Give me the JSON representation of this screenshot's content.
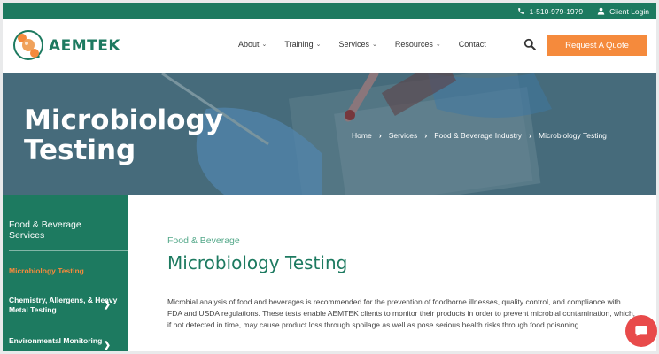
{
  "topbar": {
    "phone": "1-510-979-1979",
    "login": "Client Login"
  },
  "brand": {
    "name": "AEMTEK",
    "primary_color": "#1d7a60",
    "accent_color": "#f58a3c"
  },
  "nav": {
    "items": [
      {
        "label": "About",
        "has_dropdown": true
      },
      {
        "label": "Training",
        "has_dropdown": true
      },
      {
        "label": "Services",
        "has_dropdown": true
      },
      {
        "label": "Resources",
        "has_dropdown": true
      },
      {
        "label": "Contact",
        "has_dropdown": false
      }
    ],
    "cta": "Request A Quote"
  },
  "hero": {
    "title_line1": "Microbiology",
    "title_line2": "Testing",
    "breadcrumb": [
      "Home",
      "Services",
      "Food & Beverage Industry",
      "Microbiology Testing"
    ]
  },
  "sidebar": {
    "title": "Food & Beverage Services",
    "active_item": "Microbiology Testing",
    "items": [
      {
        "label": "Chemistry, Allergens, & Heavy Metal Testing"
      },
      {
        "label": "Environmental Monitoring"
      }
    ]
  },
  "main": {
    "eyebrow": "Food & Beverage",
    "title": "Microbiology Testing",
    "paragraph": "Microbial analysis of food and beverages is recommended for the prevention of foodborne illnesses, quality control, and compliance with FDA and USDA regulations. These tests enable AEMTEK clients to monitor their products in order to prevent microbial contamination, which, if not detected in time, may cause product loss through spoilage as well as pose serious health risks through food poisoning."
  }
}
